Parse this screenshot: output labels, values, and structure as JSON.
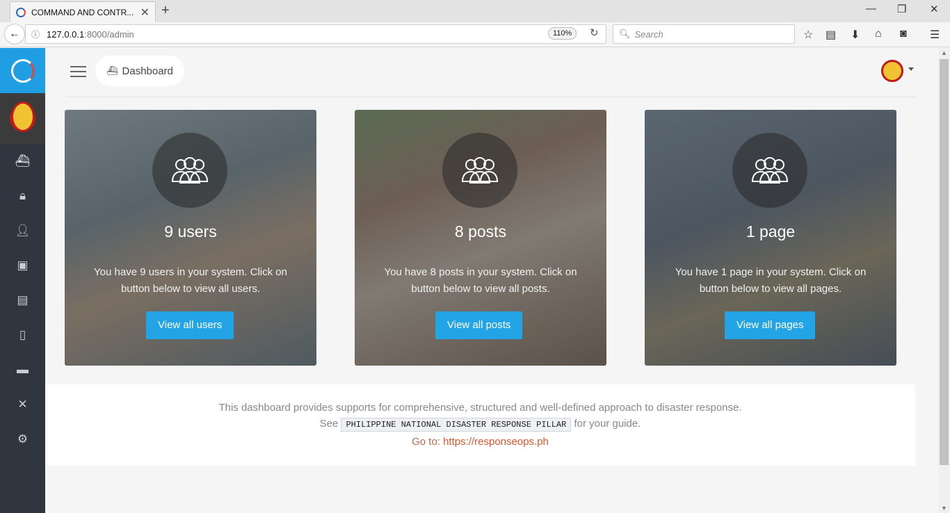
{
  "browser": {
    "tab_title": "COMMAND AND CONTR...",
    "url_host": "127.0.0.1",
    "url_path": ":8000/admin",
    "zoom": "110%",
    "search_placeholder": "Search"
  },
  "header": {
    "breadcrumb": "Dashboard"
  },
  "cards": [
    {
      "count": "9 users",
      "desc": "You have 9 users in your system. Click on button below to view all users.",
      "button": "View all users"
    },
    {
      "count": "8 posts",
      "desc": "You have 8 posts in your system. Click on button below to view all posts.",
      "button": "View all posts"
    },
    {
      "count": "1 page",
      "desc": "You have 1 page in your system. Click on button below to view all pages.",
      "button": "View all pages"
    }
  ],
  "footer": {
    "line1": "This dashboard provides supports for comprehensive, structured and well-defined approach to disaster response.",
    "see": "See",
    "code": "PHILIPPINE NATIONAL DISASTER RESPONSE PILLAR",
    "guide": "for your guide.",
    "goto": "Go to:",
    "link": "https://responseops.ph"
  },
  "sidebar": {
    "items": [
      "dashboard-icon",
      "lock-icon",
      "user-icon",
      "gallery-icon",
      "list-icon",
      "file-icon",
      "folder-icon",
      "tools-icon",
      "gear-icon"
    ]
  },
  "colors": {
    "brand": "#1f9ee4",
    "sidebar": "#2f3640",
    "button": "#23a4e6",
    "link": "#e0552a"
  }
}
